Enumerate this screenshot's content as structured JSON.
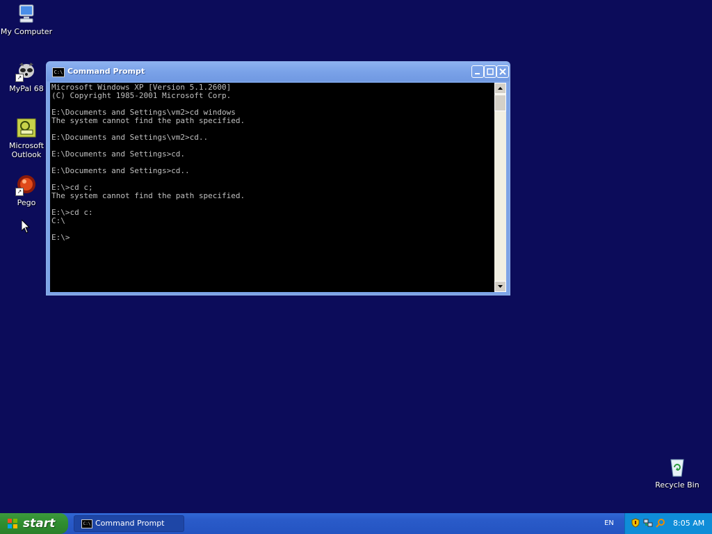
{
  "desktop": {
    "icons": [
      {
        "label": "My Computer"
      },
      {
        "label": "MyPal 68"
      },
      {
        "label": "Microsoft Outlook"
      },
      {
        "label": "Pego"
      },
      {
        "label": "Recycle Bin"
      }
    ]
  },
  "window": {
    "title": "Command Prompt",
    "console_lines": [
      "Microsoft Windows XP [Version 5.1.2600]",
      "(C) Copyright 1985-2001 Microsoft Corp.",
      "",
      "E:\\Documents and Settings\\vm2>cd windows",
      "The system cannot find the path specified.",
      "",
      "E:\\Documents and Settings\\vm2>cd..",
      "",
      "E:\\Documents and Settings>cd.",
      "",
      "E:\\Documents and Settings>cd..",
      "",
      "E:\\>cd c;",
      "The system cannot find the path specified.",
      "",
      "E:\\>cd c:",
      "C:\\",
      "",
      "E:\\>"
    ]
  },
  "taskbar": {
    "start_label": "start",
    "task_label": "Command Prompt",
    "language": "EN",
    "clock": "8:05 AM"
  },
  "colors": {
    "desktop_bg": "#0c0c5a",
    "console_bg": "#000000",
    "console_fg": "#c0c0c0",
    "taskbar": "#2a5bc9",
    "start_green": "#2f8d2f"
  }
}
